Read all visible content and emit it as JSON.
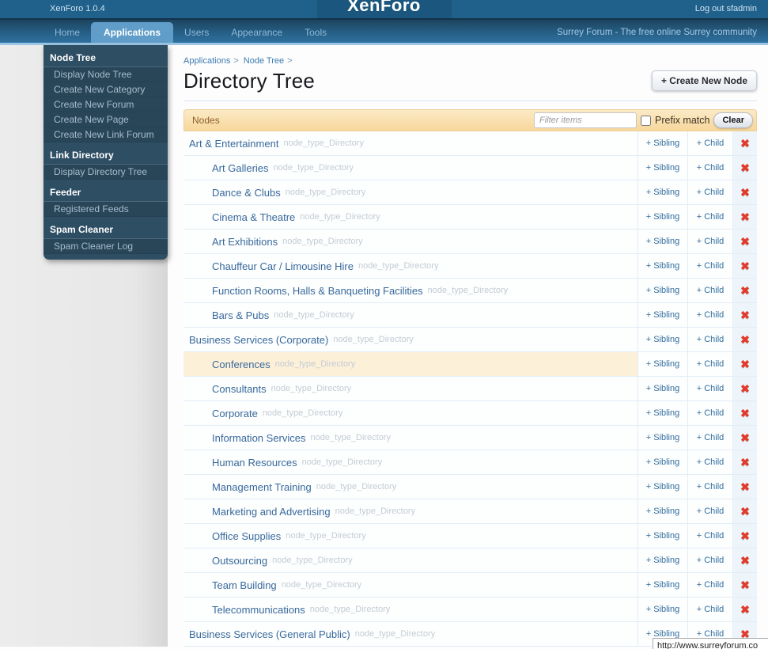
{
  "header": {
    "version": "XenForo 1.0.4",
    "logo": "XenForo",
    "logout": "Log out sfadmin",
    "tabs": [
      {
        "label": "Home",
        "active": false
      },
      {
        "label": "Applications",
        "active": true
      },
      {
        "label": "Users",
        "active": false
      },
      {
        "label": "Appearance",
        "active": false
      },
      {
        "label": "Tools",
        "active": false
      }
    ],
    "tagline": "Surrey Forum - The free online Surrey community"
  },
  "sidebar": {
    "sections": [
      {
        "title": "Node Tree",
        "items": [
          "Display Node Tree",
          "Create New Category",
          "Create New Forum",
          "Create New Page",
          "Create New Link Forum"
        ]
      },
      {
        "title": "Link Directory",
        "items": [
          "Display Directory Tree"
        ]
      },
      {
        "title": "Feeder",
        "items": [
          "Registered Feeds"
        ]
      },
      {
        "title": "Spam Cleaner",
        "items": [
          "Spam Cleaner Log"
        ]
      }
    ]
  },
  "main": {
    "breadcrumb": [
      {
        "label": "Applications",
        "arrow": ">"
      },
      {
        "label": "Node Tree",
        "arrow": ">"
      }
    ],
    "title": "Directory Tree",
    "create_button": "+ Create New Node",
    "table": {
      "header_label": "Nodes",
      "filter_placeholder": "Filter items",
      "prefix_match_label": "Prefix match",
      "clear_button": "Clear",
      "sibling_label": "+ Sibling",
      "child_label": "+ Child",
      "delete_icon": "✖",
      "node_type": "node_type_Directory",
      "rows": [
        {
          "name": "Art & Entertainment",
          "depth": 0,
          "highlighted": false
        },
        {
          "name": "Art Galleries",
          "depth": 1,
          "highlighted": false
        },
        {
          "name": "Dance & Clubs",
          "depth": 1,
          "highlighted": false
        },
        {
          "name": "Cinema & Theatre",
          "depth": 1,
          "highlighted": false
        },
        {
          "name": "Art Exhibitions",
          "depth": 1,
          "highlighted": false
        },
        {
          "name": "Chauffeur Car / Limousine Hire",
          "depth": 1,
          "highlighted": false
        },
        {
          "name": "Function Rooms, Halls & Banqueting Facilities",
          "depth": 1,
          "highlighted": false
        },
        {
          "name": "Bars & Pubs",
          "depth": 1,
          "highlighted": false
        },
        {
          "name": "Business Services (Corporate)",
          "depth": 0,
          "highlighted": false
        },
        {
          "name": "Conferences",
          "depth": 1,
          "highlighted": true
        },
        {
          "name": "Consultants",
          "depth": 1,
          "highlighted": false
        },
        {
          "name": "Corporate",
          "depth": 1,
          "highlighted": false
        },
        {
          "name": "Information Services",
          "depth": 1,
          "highlighted": false
        },
        {
          "name": "Human Resources",
          "depth": 1,
          "highlighted": false
        },
        {
          "name": "Management Training",
          "depth": 1,
          "highlighted": false
        },
        {
          "name": "Marketing and Advertising",
          "depth": 1,
          "highlighted": false
        },
        {
          "name": "Office Supplies",
          "depth": 1,
          "highlighted": false
        },
        {
          "name": "Outsourcing",
          "depth": 1,
          "highlighted": false
        },
        {
          "name": "Team Building",
          "depth": 1,
          "highlighted": false
        },
        {
          "name": "Telecommunications",
          "depth": 1,
          "highlighted": false
        },
        {
          "name": "Business Services (General Public)",
          "depth": 0,
          "highlighted": false
        }
      ]
    },
    "status_tooltip": "http://www.surreyforum.co"
  },
  "colors": {
    "topbar": "#20618c",
    "nav_active_tab": "#609dc8",
    "sidebar_panel": "#2e4e64",
    "table_header_top": "#fceac6",
    "table_header_bottom": "#f7d79c",
    "row_highlight": "#fdf0d9",
    "link": "#38699c",
    "delete_red": "#e13b2c"
  }
}
